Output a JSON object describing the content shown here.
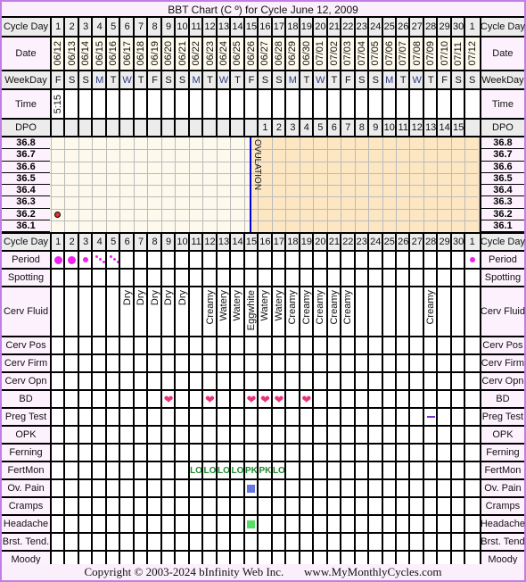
{
  "title": "BBT Chart (C º) for Cycle June 12, 2009",
  "footer": {
    "copyright": "Copyright © 2003-2024 bInfinity Web Inc.",
    "site": "www.MyMonthlyCycles.com"
  },
  "colors": {
    "border": "#c27ee6",
    "label_bg": "#fdf1fd",
    "pre_ovulation_bg": "#fdf9ec",
    "post_ovulation_bg": "#fde7c2",
    "ovulation_line": "#0000dd",
    "temp_dot": "#e83030",
    "period": "#ee22ee",
    "heart": "#e8337a",
    "fertmon": "#1f8a2e",
    "ov_pain": "#6677dd",
    "headache": "#55dd66",
    "preg_test": "#7733cc"
  },
  "cycle_days": [
    "1",
    "2",
    "3",
    "4",
    "5",
    "6",
    "7",
    "8",
    "9",
    "10",
    "11",
    "12",
    "13",
    "14",
    "15",
    "16",
    "17",
    "18",
    "19",
    "20",
    "21",
    "22",
    "23",
    "24",
    "25",
    "26",
    "27",
    "28",
    "29",
    "30",
    "1"
  ],
  "dates": [
    "06/12",
    "06/13",
    "06/14",
    "06/15",
    "06/16",
    "06/17",
    "06/18",
    "06/19",
    "06/20",
    "06/21",
    "06/22",
    "06/23",
    "06/24",
    "06/25",
    "06/26",
    "06/27",
    "06/28",
    "06/29",
    "06/30",
    "07/01",
    "07/02",
    "07/03",
    "07/04",
    "07/05",
    "07/06",
    "07/07",
    "07/08",
    "07/09",
    "07/10",
    "07/11",
    "07/12"
  ],
  "weekdays": [
    "F",
    "S",
    "S",
    "M",
    "T",
    "W",
    "T",
    "F",
    "S",
    "S",
    "M",
    "T",
    "W",
    "T",
    "F",
    "S",
    "S",
    "M",
    "T",
    "W",
    "T",
    "F",
    "S",
    "S",
    "M",
    "T",
    "W",
    "T",
    "F",
    "S",
    "S"
  ],
  "times": [
    "5:15",
    "",
    "",
    "",
    "",
    "",
    "",
    "",
    "",
    "",
    "",
    "",
    "",
    "",
    "",
    "",
    "",
    "",
    "",
    "",
    "",
    "",
    "",
    "",
    "",
    "",
    "",
    "",
    "",
    "",
    ""
  ],
  "dpo": [
    "",
    "",
    "",
    "",
    "",
    "",
    "",
    "",
    "",
    "",
    "",
    "",
    "",
    "",
    "",
    "1",
    "2",
    "3",
    "4",
    "5",
    "6",
    "7",
    "8",
    "9",
    "10",
    "11",
    "12",
    "13",
    "14",
    "15",
    ""
  ],
  "temp_axis": [
    "36.8",
    "36.7",
    "36.6",
    "36.5",
    "36.4",
    "36.3",
    "36.2",
    "36.1"
  ],
  "temperatures": [
    {
      "day": 1,
      "value": 36.2
    }
  ],
  "ovulation": {
    "label": "OVULATION",
    "after_day": 15
  },
  "labels": {
    "cycle_day": "Cycle Day",
    "date": "Date",
    "weekday": "WeekDay",
    "time": "Time",
    "dpo": "DPO",
    "period": "Period",
    "spotting": "Spotting",
    "cerv_fluid": "Cerv Fluid",
    "cerv_pos": "Cerv Pos",
    "cerv_firm": "Cerv Firm",
    "cerv_opn": "Cerv Opn",
    "bd": "BD",
    "preg_test": "Preg Test",
    "opk": "OPK",
    "ferning": "Ferning",
    "fertmon": "FertMon",
    "ov_pain": "Ov. Pain",
    "cramps": "Cramps",
    "headache": "Headache",
    "brst_tend": "Brst. Tend.",
    "brst_tend_right": "Brst. Tend",
    "moody": "Moody"
  },
  "period": [
    "heavy",
    "heavy",
    "medium",
    "spotting",
    "spotting",
    "",
    "",
    "",
    "",
    "",
    "",
    "",
    "",
    "",
    "",
    "",
    "",
    "",
    "",
    "",
    "",
    "",
    "",
    "",
    "",
    "",
    "",
    "",
    "",
    "",
    "medium"
  ],
  "cerv_fluid": [
    "",
    "",
    "",
    "",
    "",
    "Dry",
    "Dry",
    "Dry",
    "Dry",
    "Dry",
    "",
    "Creamy",
    "Watery",
    "Watery",
    "Eggwhite",
    "Watery",
    "Watery",
    "Creamy",
    "Creamy",
    "Creamy",
    "Creamy",
    "Creamy",
    "",
    "",
    "",
    "",
    "",
    "Creamy",
    "",
    "",
    ""
  ],
  "bd_days": [
    9,
    12,
    15,
    16,
    17,
    19
  ],
  "preg_test": {
    "day": 28,
    "result": "negative"
  },
  "fertmon": [
    "",
    "",
    "",
    "",
    "",
    "",
    "",
    "",
    "",
    "",
    "LO",
    "LO",
    "LO",
    "LO",
    "PK",
    "PK",
    "LO",
    "",
    "",
    "",
    "",
    "",
    "",
    "",
    "",
    "",
    "",
    "",
    "",
    "",
    ""
  ],
  "ov_pain_days": [
    15
  ],
  "headache_days": [
    15
  ]
}
